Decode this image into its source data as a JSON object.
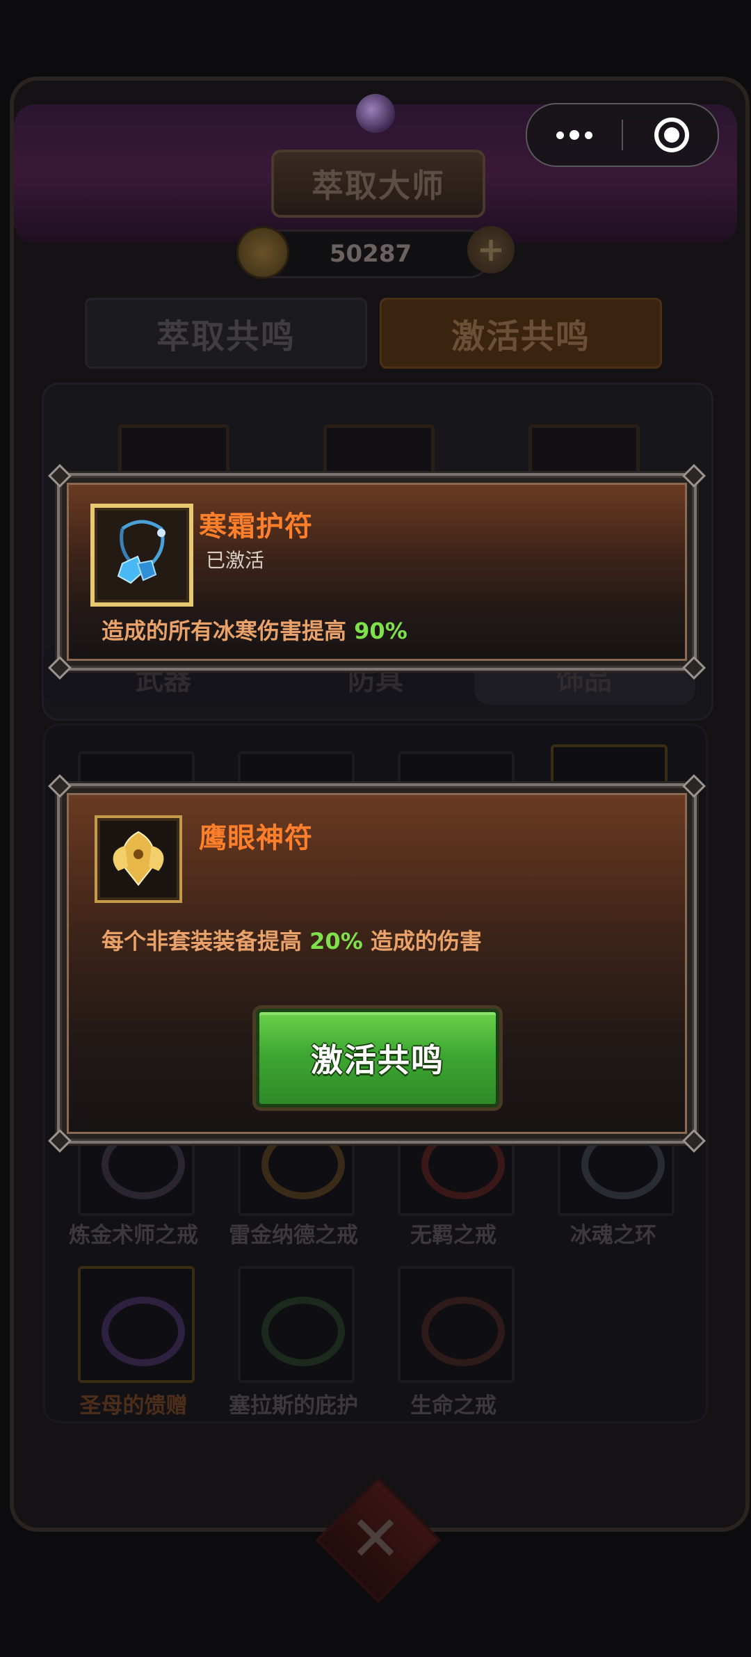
{
  "header": {
    "title": "萃取大师",
    "coins": "50287",
    "plus_symbol": "+"
  },
  "tabs": [
    {
      "label": "萃取共鸣"
    },
    {
      "label": "激活共鸣"
    }
  ],
  "categories": [
    {
      "label": "武器"
    },
    {
      "label": "防具"
    },
    {
      "label": "饰品"
    }
  ],
  "grid_items": [
    {
      "name": "炼金术师之戒"
    },
    {
      "name": "雷金纳德之戒"
    },
    {
      "name": "无羁之戒"
    },
    {
      "name": "冰魂之环"
    },
    {
      "name": "圣母的馈赠"
    },
    {
      "name": "塞拉斯的庇护"
    },
    {
      "name": "生命之戒"
    }
  ],
  "popup_frost": {
    "title": "寒霜护符",
    "status": "已激活",
    "desc_prefix": "造成的所有冰寒伤害提高 ",
    "desc_value": "90%",
    "icon": "frost-amulet-icon"
  },
  "popup_hawk": {
    "title": "鹰眼神符",
    "desc_prefix": "每个非套装装备提高 ",
    "desc_value": "20%",
    "desc_suffix": " 造成的伤害",
    "button_label": "激活共鸣",
    "icon": "hawk-eye-rune-icon"
  },
  "colors": {
    "title_orange": "#ff7f2a",
    "desc_orange": "#e9a269",
    "percent_green": "#7ee04a",
    "button_green": "#3ea832"
  }
}
